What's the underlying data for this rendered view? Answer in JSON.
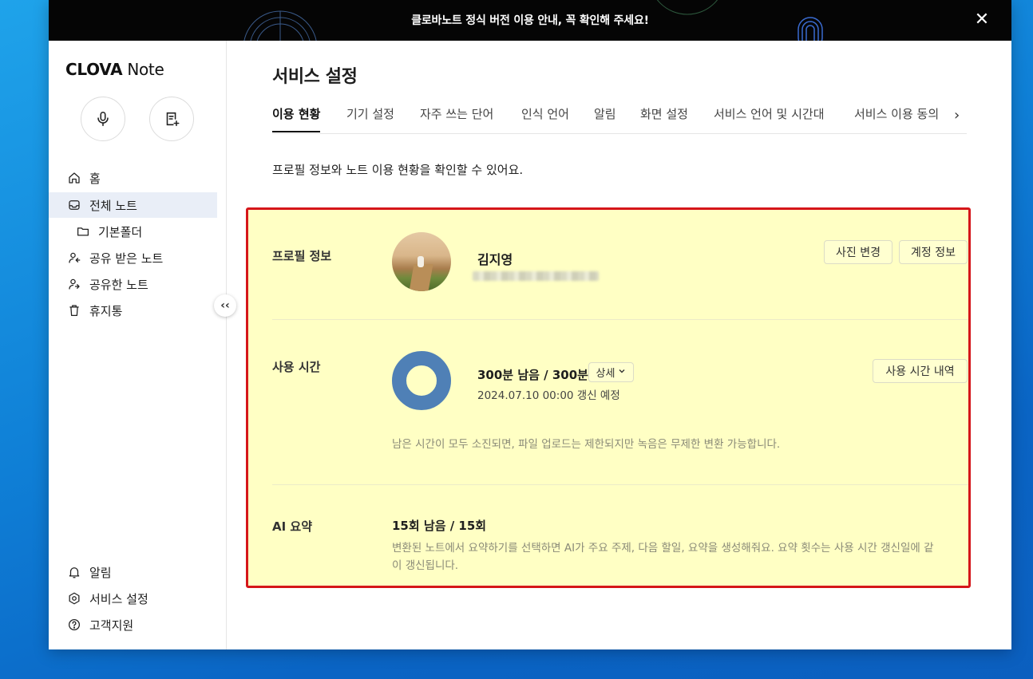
{
  "banner": {
    "text": "클로바노트 정식 버전 이용 안내, 꼭 확인해 주세요!",
    "close_icon": "close-icon"
  },
  "sidebar": {
    "logo_bold": "CLOVA",
    "logo_rest": " Note",
    "nav": [
      {
        "label": "홈",
        "icon": "home-icon"
      },
      {
        "label": "전체 노트",
        "icon": "inbox-icon"
      },
      {
        "label": "기본폴더",
        "icon": "folder-icon"
      },
      {
        "label": "공유 받은 노트",
        "icon": "shared-received-icon"
      },
      {
        "label": "공유한 노트",
        "icon": "shared-icon"
      },
      {
        "label": "휴지통",
        "icon": "trash-icon"
      }
    ],
    "bottom": [
      {
        "label": "알림",
        "icon": "bell-icon"
      },
      {
        "label": "서비스 설정",
        "icon": "gear-icon"
      },
      {
        "label": "고객지원",
        "icon": "help-icon"
      }
    ]
  },
  "main": {
    "title": "서비스 설정",
    "tabs": [
      "이용 현황",
      "기기 설정",
      "자주 쓰는 단어",
      "인식 언어",
      "알림",
      "화면 설정",
      "서비스 언어 및 시간대",
      "서비스 이용 동의"
    ],
    "description": "프로필 정보와 노트 이용 현황을 확인할 수 있어요.",
    "profile": {
      "label": "프로필 정보",
      "name": "김지영",
      "change_photo": "사진 변경",
      "account_info": "계정 정보"
    },
    "usage": {
      "label": "사용 시간",
      "remaining": "300분 남음 / 300분",
      "detail": "상세",
      "renew": "2024.07.10 00:00 갱신 예정",
      "history": "사용 시간 내역",
      "note": "남은 시간이 모두 소진되면, 파일 업로드는 제한되지만 녹음은 무제한 변환 가능합니다.",
      "used_fraction": 0
    },
    "ai": {
      "label": "AI 요약",
      "remaining": "15회 남음 / 15회",
      "desc": "변환된 노트에서 요약하기를 선택하면 AI가 주요 주제, 다음 할일, 요약을 생성해줘요. 요약 횟수는 사용 시간 갱신일에 같이 갱신됩니다."
    }
  },
  "colors": {
    "highlight": "#ffffc4",
    "outline": "#d5161a",
    "donut": "#4f80b6",
    "active_nav": "#e9eef7"
  }
}
